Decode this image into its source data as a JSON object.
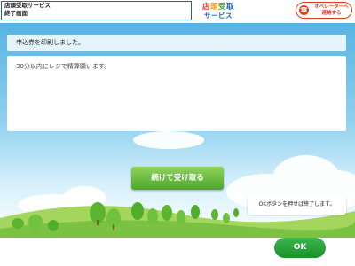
{
  "header": {
    "title_line1": "店頭受取サービス",
    "title_line2": "終了画面",
    "brand_line1_chars": [
      "店",
      "頭",
      "受",
      "取"
    ],
    "brand_line1_colors": [
      "#e23b1c",
      "#f39a1e",
      "#3aa535",
      "#1b63b3"
    ],
    "brand_line2": "サービス",
    "operator_button_line1": "オペレーターへ",
    "operator_button_line2": "連絡する",
    "operator_icon": "operator-headset-icon"
  },
  "main": {
    "message": "申込券を印刷しました。",
    "instruction": "30分以内にレジで精算願います。",
    "continue_button": "続けて受け取る",
    "notice": "OKボタンを押せば終了します。"
  },
  "footer": {
    "ok_button": "OK"
  },
  "colors": {
    "accent_blue": "#1b63b3",
    "operator_red": "#e23b1c",
    "button_green": "#3fb54a",
    "sky": "#57b3e3",
    "grass": "#7cc242"
  }
}
